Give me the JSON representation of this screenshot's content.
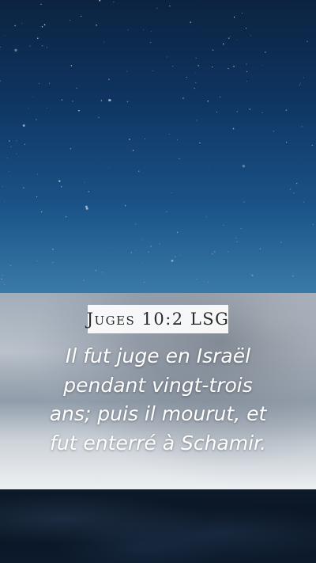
{
  "reference": "Juges 10:2 LSG",
  "verse_lines": [
    "Il fut juge en Israël",
    "pendant vingt-trois",
    "ans; puis il mourut, et",
    "fut enterré à Schamir."
  ],
  "colors": {
    "sky_top": "#0b2340",
    "sky_bottom": "#3a7aa8",
    "banner_label_bg": "#ffffff",
    "verse_text": "#ffffff"
  }
}
